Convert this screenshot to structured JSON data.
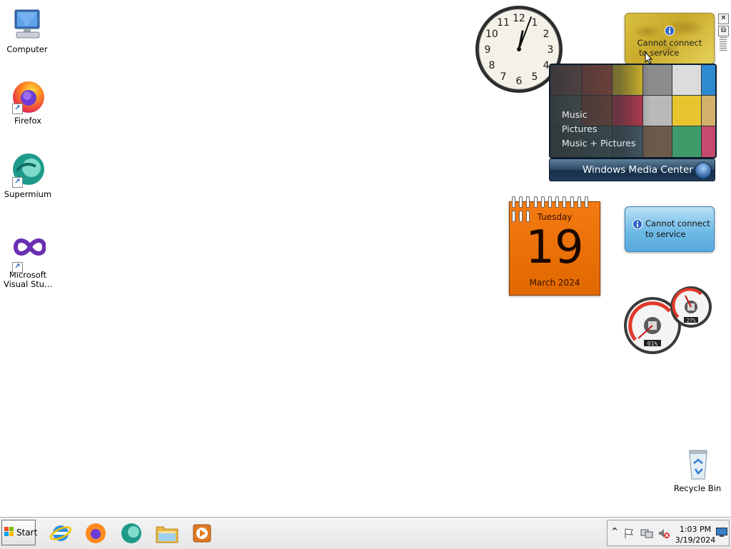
{
  "desktop": {
    "icons": [
      {
        "label": "Computer",
        "icon": "computer-icon"
      },
      {
        "label": "Firefox",
        "icon": "firefox-icon"
      },
      {
        "label": "Supermium",
        "icon": "supermium-icon"
      },
      {
        "label": "Microsoft Visual Stu...",
        "icon": "visual-studio-icon"
      },
      {
        "label": "Recycle Bin",
        "icon": "recycle-bin-icon"
      }
    ]
  },
  "gadgets": {
    "clock": {
      "numbers": [
        "12",
        "1",
        "2",
        "3",
        "4",
        "5",
        "6",
        "7",
        "8",
        "9",
        "10",
        "11"
      ]
    },
    "weather_top": {
      "message": "Cannot connect to service",
      "line1": "Cannot connect",
      "line2": "to service"
    },
    "media_center": {
      "menu": [
        "Music",
        "Pictures",
        "Music + Pictures"
      ],
      "brand": "Windows Media Center"
    },
    "calendar": {
      "weekday": "Tuesday",
      "day": "19",
      "month_year": "March 2024"
    },
    "weather_bottom": {
      "line1": "Cannot connect",
      "line2": "to service"
    },
    "cpu_meter": {
      "cpu_label": "01%",
      "mem_label": "27%"
    }
  },
  "gadget_controls": {
    "close": "✕",
    "options": "⧉"
  },
  "taskbar": {
    "start_label": "Start",
    "pinned": [
      "internet-explorer-icon",
      "firefox-icon",
      "supermium-icon",
      "explorer-folder-icon",
      "media-player-icon"
    ],
    "tray": {
      "time": "1:03 PM",
      "date": "3/19/2024",
      "chevron": "^"
    }
  },
  "colors": {
    "calendar_orange": "#f07010",
    "weather_gold": "#d8c040",
    "weather_blue": "#6ebae6",
    "media_bar": "#1e3a58"
  }
}
